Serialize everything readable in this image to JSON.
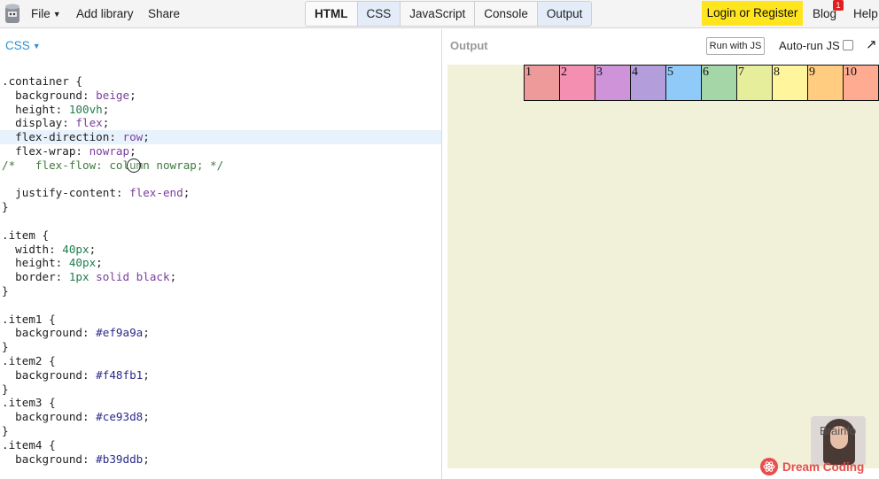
{
  "topbar": {
    "menu": {
      "file": "File",
      "add_library": "Add library",
      "share": "Share"
    },
    "tabs": [
      "HTML",
      "CSS",
      "JavaScript",
      "Console",
      "Output"
    ],
    "login": "Login or Register",
    "blog": "Blog",
    "blog_badge": "1",
    "help": "Help"
  },
  "editor": {
    "language": "CSS",
    "lines": [
      [
        {
          "t": ".container {",
          "c": ""
        }
      ],
      [
        {
          "t": "  background: ",
          "c": ""
        },
        {
          "t": "beige",
          "c": "val"
        },
        {
          "t": ";",
          "c": ""
        }
      ],
      [
        {
          "t": "  height: ",
          "c": ""
        },
        {
          "t": "100vh",
          "c": "num"
        },
        {
          "t": ";",
          "c": ""
        }
      ],
      [
        {
          "t": "  display: ",
          "c": ""
        },
        {
          "t": "flex",
          "c": "val"
        },
        {
          "t": ";",
          "c": ""
        }
      ],
      [
        {
          "t": "  flex-direction: ",
          "c": ""
        },
        {
          "t": "row",
          "c": "val"
        },
        {
          "t": ";",
          "c": ""
        }
      ],
      [
        {
          "t": "  flex-wrap: ",
          "c": ""
        },
        {
          "t": "nowrap",
          "c": "val"
        },
        {
          "t": ";",
          "c": ""
        }
      ],
      [
        {
          "t": "/*   flex-flow: column nowrap; */",
          "c": "cmt"
        }
      ],
      [],
      [
        {
          "t": "  justify-content: ",
          "c": ""
        },
        {
          "t": "flex-end",
          "c": "val"
        },
        {
          "t": ";",
          "c": ""
        }
      ],
      [
        {
          "t": "}",
          "c": ""
        }
      ],
      [],
      [
        {
          "t": ".item {",
          "c": ""
        }
      ],
      [
        {
          "t": "  width: ",
          "c": ""
        },
        {
          "t": "40px",
          "c": "num"
        },
        {
          "t": ";",
          "c": ""
        }
      ],
      [
        {
          "t": "  height: ",
          "c": ""
        },
        {
          "t": "40px",
          "c": "num"
        },
        {
          "t": ";",
          "c": ""
        }
      ],
      [
        {
          "t": "  border: ",
          "c": ""
        },
        {
          "t": "1px",
          "c": "num"
        },
        {
          "t": " solid black",
          "c": "val"
        },
        {
          "t": ";",
          "c": ""
        }
      ],
      [
        {
          "t": "}",
          "c": ""
        }
      ],
      [],
      [
        {
          "t": ".item1 {",
          "c": ""
        }
      ],
      [
        {
          "t": "  background: ",
          "c": ""
        },
        {
          "t": "#ef9a9a",
          "c": "hex"
        },
        {
          "t": ";",
          "c": ""
        }
      ],
      [
        {
          "t": "}",
          "c": ""
        }
      ],
      [
        {
          "t": ".item2 {",
          "c": ""
        }
      ],
      [
        {
          "t": "  background: ",
          "c": ""
        },
        {
          "t": "#f48fb1",
          "c": "hex"
        },
        {
          "t": ";",
          "c": ""
        }
      ],
      [
        {
          "t": "}",
          "c": ""
        }
      ],
      [
        {
          "t": ".item3 {",
          "c": ""
        }
      ],
      [
        {
          "t": "  background: ",
          "c": ""
        },
        {
          "t": "#ce93d8",
          "c": "hex"
        },
        {
          "t": ";",
          "c": ""
        }
      ],
      [
        {
          "t": "}",
          "c": ""
        }
      ],
      [
        {
          "t": ".item4 {",
          "c": ""
        }
      ],
      [
        {
          "t": "  background: ",
          "c": ""
        },
        {
          "t": "#b39ddb",
          "c": "hex"
        },
        {
          "t": ";",
          "c": ""
        }
      ]
    ]
  },
  "output": {
    "title": "Output",
    "run_button": "Run with JS",
    "autorun_label": "Auto-run JS",
    "autorun_checked": false,
    "items": [
      {
        "label": "1",
        "color": "#ef9a9a"
      },
      {
        "label": "2",
        "color": "#f48fb1"
      },
      {
        "label": "3",
        "color": "#ce93d8"
      },
      {
        "label": "4",
        "color": "#b39ddb"
      },
      {
        "label": "5",
        "color": "#90caf9"
      },
      {
        "label": "6",
        "color": "#a5d6a7"
      },
      {
        "label": "7",
        "color": "#e6ee9c"
      },
      {
        "label": "8",
        "color": "#fff59d"
      },
      {
        "label": "9",
        "color": "#ffcc80"
      },
      {
        "label": "10",
        "color": "#ffab91"
      }
    ]
  },
  "overlay": {
    "cam_label": "Brainfo",
    "watermark": "Dream Coding"
  }
}
